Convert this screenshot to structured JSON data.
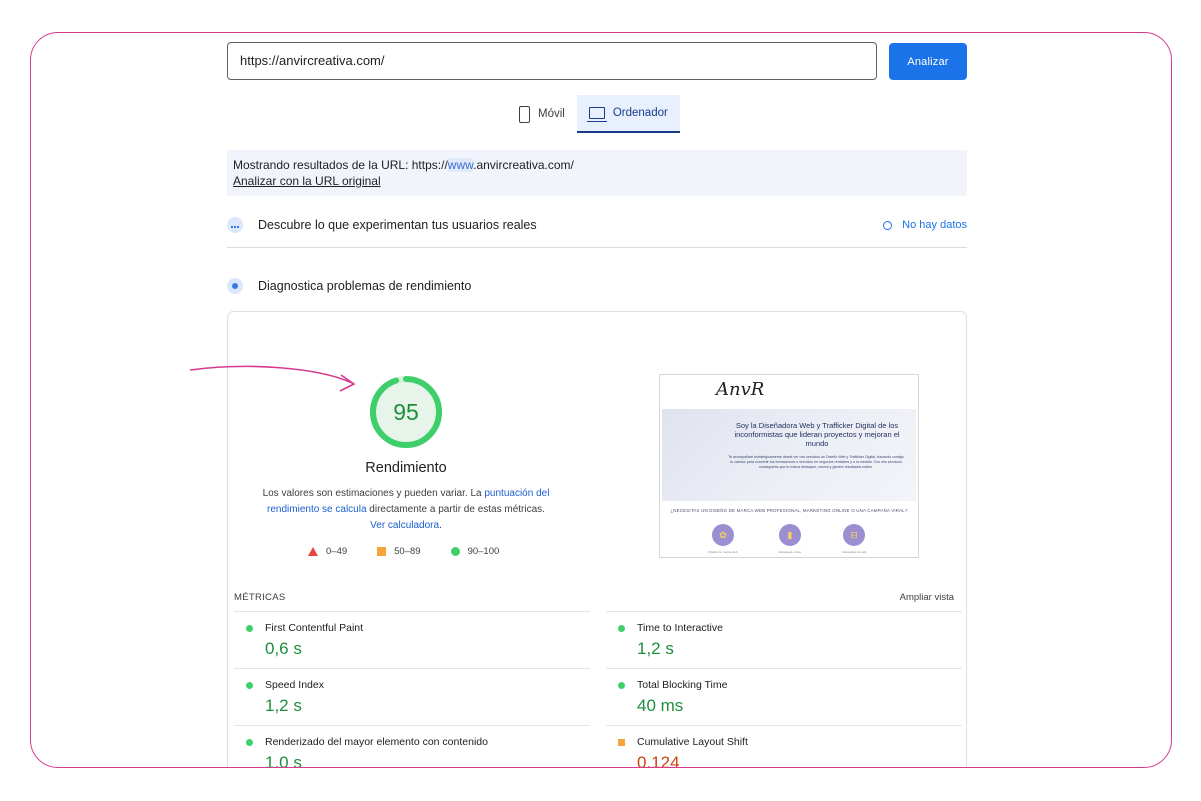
{
  "url_bar": {
    "value": "https://anvircreativa.com/",
    "button": "Analizar"
  },
  "device_tabs": [
    {
      "label": "Móvil",
      "icon": "phone-icon",
      "active": false
    },
    {
      "label": "Ordenador",
      "icon": "laptop-icon",
      "active": true
    }
  ],
  "notice": {
    "prefix": "Mostrando resultados de la URL: https://",
    "highlight": "www",
    "suffix": ".anvircreativa.com/",
    "link": "Analizar con la URL original"
  },
  "field_section": {
    "title": "Descubre lo que experimentan tus usuarios reales",
    "status": "No hay datos"
  },
  "diag_section": {
    "title": "Diagnostica problemas de rendimiento"
  },
  "performance": {
    "score": "95",
    "label": "Rendimiento",
    "desc_1": "Los valores son estimaciones y pueden variar. La ",
    "desc_link_1": "puntuación del rendimiento se calcula",
    "desc_2": " directamente a partir de estas métricas. ",
    "desc_link_2": "Ver calculadora",
    "desc_3": ".",
    "legend": [
      "0–49",
      "50–89",
      "90–100"
    ],
    "score_fraction": 0.95
  },
  "thumbnail": {
    "logo": "AnvR",
    "hero_title": "Soy la Diseñadora Web y Trafficker Digital de los inconformistas que lideran proyectos y mejoran el mundo",
    "hero_body": "Te acompañaré estratégicamente desde ver mis servicios de Diseño Web y Trafficker Digital, trazando contigo tu camino para convertir tus formaciones o servicios en negocios rentables y a la medida. Con mis servicios conseguirás que tu marca destaque, crezca y genere resultados reales.",
    "question": "¿NECESITAS UN DISEÑO DE MARCA WEB PROFESIONAL, MARKETING ONLINE O UNA CAMPAÑA VIRAL?",
    "captions": [
      "Diseño de marca web",
      "Estrategia online",
      "Campañas de ads"
    ]
  },
  "metrics": {
    "label": "MÉTRICAS",
    "expand": "Ampliar vista",
    "items": [
      {
        "name": "First Contentful Paint",
        "value": "0,6 s",
        "rating": "good"
      },
      {
        "name": "Time to Interactive",
        "value": "1,2 s",
        "rating": "good"
      },
      {
        "name": "Speed Index",
        "value": "1,2 s",
        "rating": "good"
      },
      {
        "name": "Total Blocking Time",
        "value": "40 ms",
        "rating": "good"
      },
      {
        "name": "Renderizado del mayor elemento con contenido",
        "value": "1,0 s",
        "rating": "good"
      },
      {
        "name": "Cumulative Layout Shift",
        "value": "0,124",
        "rating": "average"
      }
    ]
  },
  "colors": {
    "accent": "#1a73e8",
    "good": "#1e8e3e",
    "average": "#c5460d",
    "frame": "#d63a8f"
  }
}
